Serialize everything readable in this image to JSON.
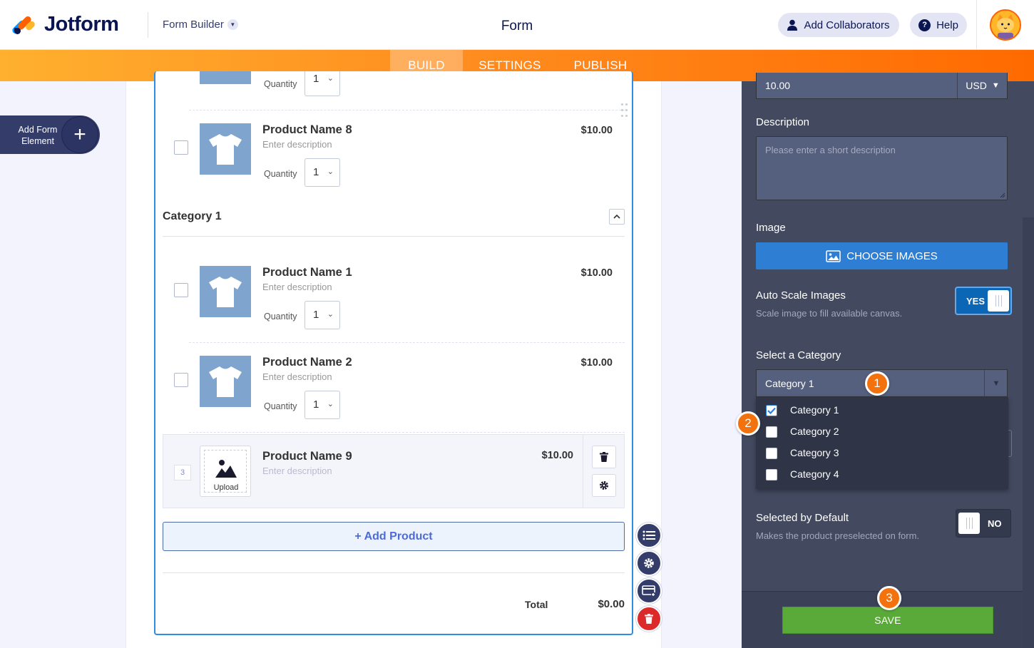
{
  "header": {
    "brand": "Jotform",
    "menu_label": "Form Builder",
    "form_title": "Form",
    "collab_label": "Add Collaborators",
    "help_label": "Help",
    "help_glyph": "?",
    "brand_colors": [
      "#0099FF",
      "#FF6100",
      "#FFB629",
      "#0A1551"
    ]
  },
  "nav": {
    "tabs": [
      "BUILD",
      "SETTINGS",
      "PUBLISH"
    ],
    "active": "BUILD"
  },
  "sidebar": {
    "add_element_label": "Add Form Element",
    "add_element_icon": "+"
  },
  "products": {
    "top_partial": {
      "quantity_label": "Quantity",
      "quantity": "1"
    },
    "category_title": "Category 1",
    "items": [
      {
        "name": "Product Name 8",
        "desc": "Enter description",
        "price": "$10.00",
        "quantity_label": "Quantity",
        "quantity": "1"
      },
      {
        "name": "Product Name 1",
        "desc": "Enter description",
        "price": "$10.00",
        "quantity_label": "Quantity",
        "quantity": "1"
      },
      {
        "name": "Product Name 2",
        "desc": "Enter description",
        "price": "$10.00",
        "quantity_label": "Quantity",
        "quantity": "1"
      }
    ],
    "editing": {
      "index": "3",
      "name": "Product Name 9",
      "desc": "Enter description",
      "price": "$10.00",
      "upload_label": "Upload"
    },
    "add_product_label": "+ Add Product",
    "total_label": "Total",
    "total_value": "$0.00"
  },
  "panel": {
    "price_value": "10.00",
    "currency": "USD",
    "description_label": "Description",
    "description_placeholder": "Please enter a short description",
    "image_label": "Image",
    "choose_images_label": "CHOOSE IMAGES",
    "auto_scale_label": "Auto Scale Images",
    "auto_scale_sub": "Scale image to fill available canvas.",
    "auto_scale_value": "YES",
    "select_category_label": "Select a Category",
    "select_category_value": "Category 1",
    "categories": [
      {
        "label": "Category 1",
        "checked": true
      },
      {
        "label": "Category 2",
        "checked": false
      },
      {
        "label": "Category 3",
        "checked": false
      },
      {
        "label": "Category 4",
        "checked": false
      }
    ],
    "selected_default_label": "Selected by Default",
    "selected_default_sub": "Makes the product preselected on form.",
    "selected_default_value": "NO",
    "save_label": "SAVE"
  },
  "markers": [
    "1",
    "2",
    "3"
  ],
  "colors": {
    "accent_orange": "#FF6100",
    "field_border": "#2D8CE3",
    "save_green": "#5AAA3A",
    "choose_blue": "#2E7FD4",
    "panel_bg": "#434A60"
  }
}
